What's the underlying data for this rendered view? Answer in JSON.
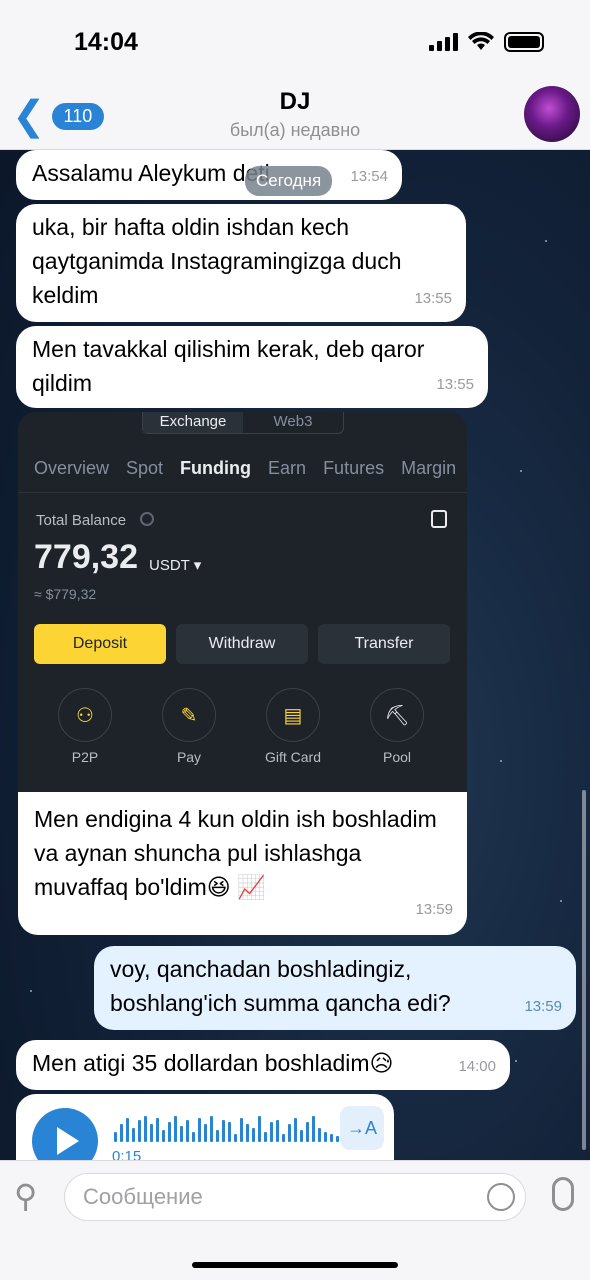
{
  "status": {
    "time": "14:04"
  },
  "header": {
    "back_count": "110",
    "title": "DJ",
    "subtitle": "был(а) недавно"
  },
  "date_pill": "Сегодня",
  "messages": [
    {
      "text": "Assalamu Aleykum deti",
      "time": "13:54"
    },
    {
      "text": "uka, bir hafta oldin ishdan kech qaytganimda Instagramingizga duch keldim",
      "time": "13:55"
    },
    {
      "text": "Men tavakkal qilishim kerak, deb qaror qildim",
      "time": "13:55"
    },
    {
      "text": "Men endigina 4 kun oldin ish boshladim va aynan shuncha pul ishlashga muvaffaq bo'ldim😆 📈",
      "time": "13:59"
    },
    {
      "text": "voy, qanchadan boshladingiz, boshlang'ich summa qancha edi?",
      "time": "13:59"
    },
    {
      "text": "Men atigi 35 dollardan boshladim😥",
      "time": "14:00"
    }
  ],
  "screenshot": {
    "seg": [
      "Exchange",
      "Web3"
    ],
    "tabs": [
      "Overview",
      "Spot",
      "Funding",
      "Earn",
      "Futures",
      "Margin"
    ],
    "total_label": "Total Balance",
    "balance": "779,32",
    "unit": "USDT ▾",
    "usd": "≈ $779,32",
    "buttons": [
      "Deposit",
      "Withdraw",
      "Transfer"
    ],
    "icons": [
      "P2P",
      "Pay",
      "Gift Card",
      "Pool"
    ]
  },
  "voice": {
    "duration": "0:15",
    "translate": "→A"
  },
  "input": {
    "placeholder": "Сообщение"
  }
}
